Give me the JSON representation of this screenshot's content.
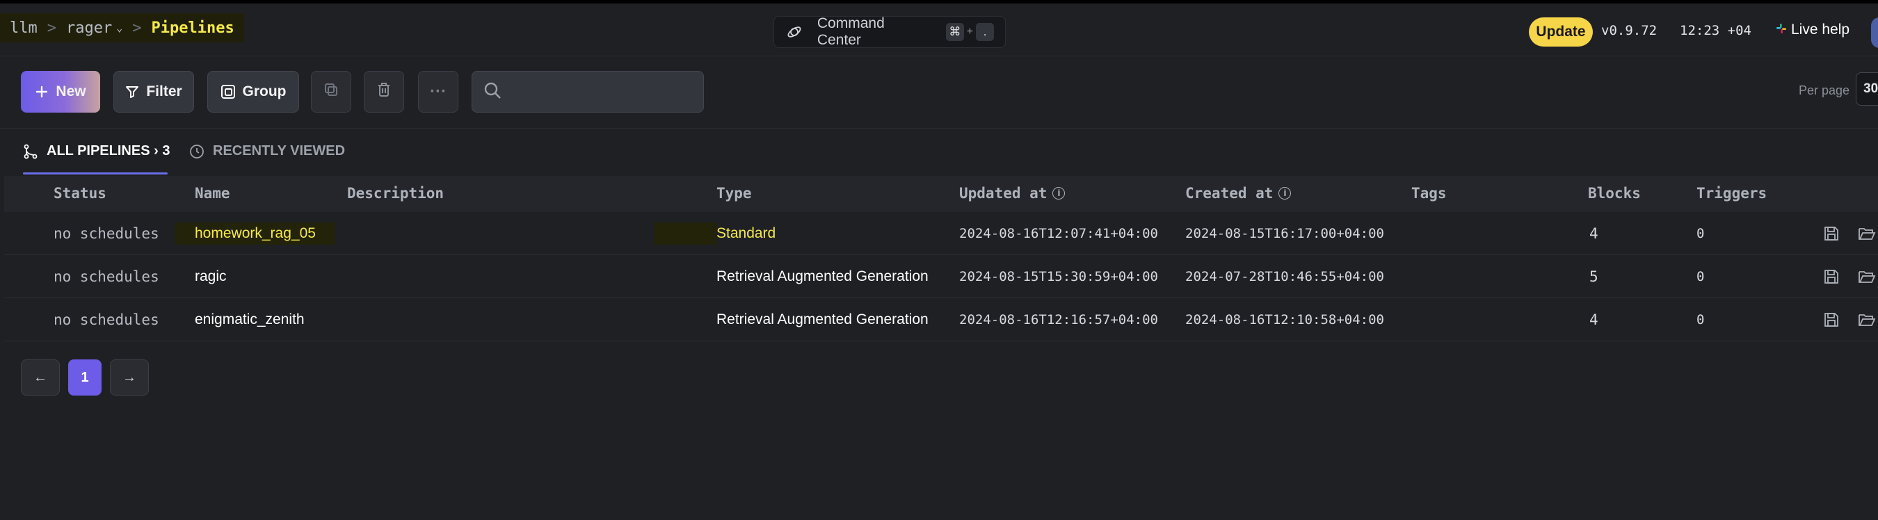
{
  "breadcrumbs": {
    "root": "llm",
    "project": "rager",
    "current": "Pipelines"
  },
  "command_center": {
    "label": "Command Center",
    "key1": "⌘",
    "plus": "+",
    "key2": "."
  },
  "header": {
    "update_label": "Update",
    "version": "v0.9.72",
    "clock": "12:23 +04",
    "help_label": "Live help"
  },
  "toolbar": {
    "new_label": "New",
    "filter_label": "Filter",
    "group_label": "Group",
    "more_label": "···",
    "search_placeholder": ""
  },
  "per_page": {
    "label": "Per page",
    "value": "30"
  },
  "tabs": {
    "all_label": "ALL PIPELINES › 3",
    "recent_label": "RECENTLY VIEWED"
  },
  "table": {
    "columns": {
      "status": "Status",
      "name": "Name",
      "description": "Description",
      "type": "Type",
      "updated": "Updated at",
      "created": "Created at",
      "tags": "Tags",
      "blocks": "Blocks",
      "triggers": "Triggers"
    },
    "rows": [
      {
        "status": "no schedules",
        "name": "homework_rag_05",
        "description": "",
        "type": "Standard",
        "updated": "2024-08-16T12:07:41+04:00",
        "created": "2024-08-15T16:17:00+04:00",
        "tags": "",
        "blocks": "4",
        "triggers": "0"
      },
      {
        "status": "no schedules",
        "name": "ragic",
        "description": "",
        "type": "Retrieval Augmented Generation",
        "updated": "2024-08-15T15:30:59+04:00",
        "created": "2024-07-28T10:46:55+04:00",
        "tags": "",
        "blocks": "5",
        "triggers": "0"
      },
      {
        "status": "no schedules",
        "name": "enigmatic_zenith",
        "description": "",
        "type": "Retrieval Augmented Generation",
        "updated": "2024-08-16T12:16:57+04:00",
        "created": "2024-08-16T12:10:58+04:00",
        "tags": "",
        "blocks": "4",
        "triggers": "0"
      }
    ]
  },
  "pagination": {
    "prev": "←",
    "current": "1",
    "next": "→"
  },
  "icons": [
    "chevron-down-icon",
    "satellite-icon",
    "slack-icon",
    "plus-icon",
    "filter-icon",
    "group-icon",
    "copy-icon",
    "trash-icon",
    "search-icon",
    "pipeline-tree-icon",
    "clock-icon",
    "info-icon",
    "save-icon",
    "folder-icon",
    "arrow-left-icon",
    "arrow-right-icon"
  ],
  "colors": {
    "accent": "#6c5ce7",
    "highlight_yellow": "#f5e94b",
    "update_badge": "#f7d548",
    "background": "#1f2024"
  }
}
